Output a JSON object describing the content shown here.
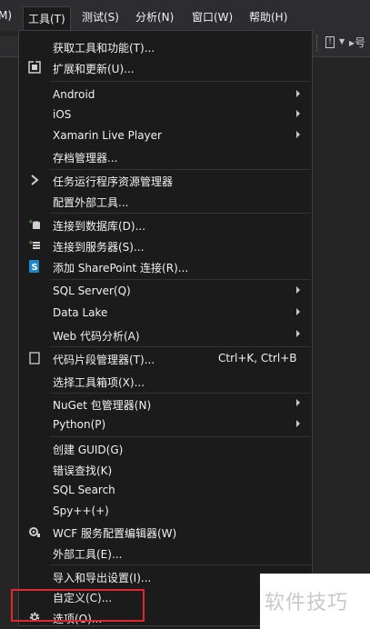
{
  "menubar": {
    "items": [
      {
        "label": "M)"
      },
      {
        "label": "工具(T)"
      },
      {
        "label": "测试(S)"
      },
      {
        "label": "分析(N)"
      },
      {
        "label": "窗口(W)"
      },
      {
        "label": "帮助(H)"
      }
    ]
  },
  "toolbar_right": {
    "text": "▸号"
  },
  "tools_menu": {
    "items": [
      {
        "label": "获取工具和功能(T)...",
        "shortcut": "",
        "icon": "",
        "submenu": false
      },
      {
        "label": "扩展和更新(U)...",
        "shortcut": "",
        "icon": "extensions-icon",
        "submenu": false
      },
      {
        "label": "Android",
        "shortcut": "",
        "icon": "",
        "submenu": true
      },
      {
        "label": "iOS",
        "shortcut": "",
        "icon": "",
        "submenu": true
      },
      {
        "label": "Xamarin Live Player",
        "shortcut": "",
        "icon": "",
        "submenu": true
      },
      {
        "label": "存档管理器...",
        "shortcut": "",
        "icon": "",
        "submenu": false
      },
      {
        "label": "任务运行程序资源管理器",
        "shortcut": "",
        "icon": "task-runner-icon",
        "submenu": false
      },
      {
        "label": "配置外部工具...",
        "shortcut": "",
        "icon": "",
        "submenu": false
      },
      {
        "label": "连接到数据库(D)...",
        "shortcut": "",
        "icon": "connect-database-icon",
        "submenu": false
      },
      {
        "label": "连接到服务器(S)...",
        "shortcut": "",
        "icon": "connect-server-icon",
        "submenu": false
      },
      {
        "label": "添加 SharePoint 连接(R)...",
        "shortcut": "",
        "icon": "sharepoint-icon",
        "submenu": false
      },
      {
        "label": "SQL Server(Q)",
        "shortcut": "",
        "icon": "",
        "submenu": true
      },
      {
        "label": "Data Lake",
        "shortcut": "",
        "icon": "",
        "submenu": true
      },
      {
        "label": "Web 代码分析(A)",
        "shortcut": "",
        "icon": "",
        "submenu": true
      },
      {
        "label": "代码片段管理器(T)...",
        "shortcut": "Ctrl+K, Ctrl+B",
        "icon": "snippet-checkbox-icon",
        "submenu": false
      },
      {
        "label": "选择工具箱项(X)...",
        "shortcut": "",
        "icon": "",
        "submenu": false
      },
      {
        "label": "NuGet 包管理器(N)",
        "shortcut": "",
        "icon": "",
        "submenu": true
      },
      {
        "label": "Python(P)",
        "shortcut": "",
        "icon": "",
        "submenu": true
      },
      {
        "label": "创建 GUID(G)",
        "shortcut": "",
        "icon": "",
        "submenu": false
      },
      {
        "label": "错误查找(K)",
        "shortcut": "",
        "icon": "",
        "submenu": false
      },
      {
        "label": "SQL Search",
        "shortcut": "",
        "icon": "",
        "submenu": false
      },
      {
        "label": "Spy++(+)",
        "shortcut": "",
        "icon": "",
        "submenu": false
      },
      {
        "label": "WCF 服务配置编辑器(W)",
        "shortcut": "",
        "icon": "wcf-config-icon",
        "submenu": false
      },
      {
        "label": "外部工具(E)...",
        "shortcut": "",
        "icon": "",
        "submenu": false
      },
      {
        "label": "导入和导出设置(I)...",
        "shortcut": "",
        "icon": "",
        "submenu": false
      },
      {
        "label": "自定义(C)...",
        "shortcut": "",
        "icon": "",
        "submenu": false
      },
      {
        "label": "选项(O)...",
        "shortcut": "",
        "icon": "gear-icon",
        "submenu": false
      }
    ]
  },
  "colors": {
    "menu_background": "#1b1b1c",
    "menubar_background": "#2d2d30",
    "highlight_box": "#e0262f",
    "sharepoint_icon": "#1e88c7",
    "text": "#f1f1f1"
  },
  "watermark": {
    "text": "软件技巧"
  }
}
